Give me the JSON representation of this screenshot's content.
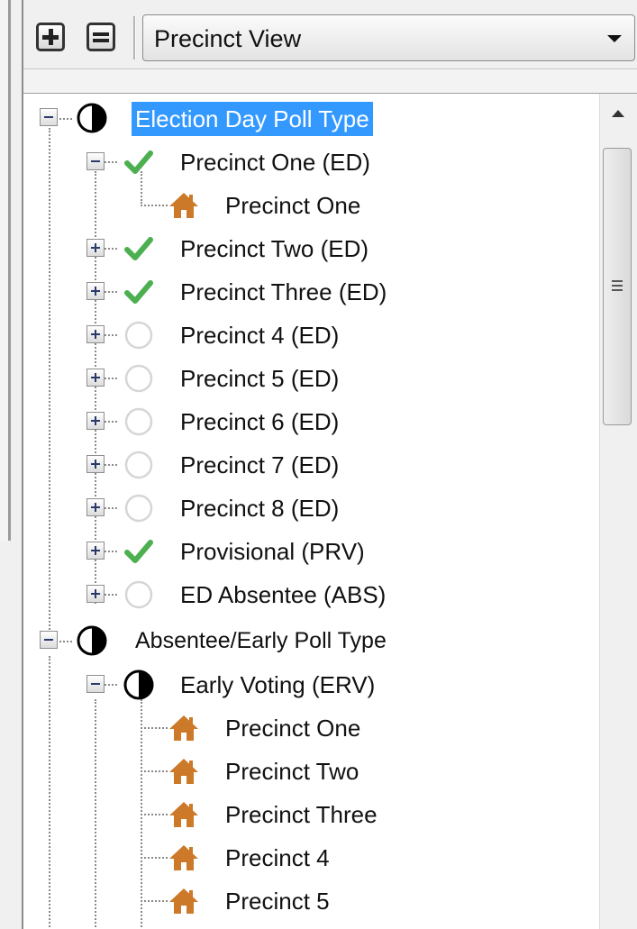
{
  "toolbar": {
    "expand_all": "expand-all",
    "collapse_all": "collapse-all",
    "view_select": {
      "value": "Precinct View"
    }
  },
  "tree": {
    "groups": [
      {
        "label": "Election Day Poll Type",
        "icon": "half-circle-icon",
        "selected": true,
        "expanded": true,
        "children": [
          {
            "label": "Precinct One (ED)",
            "status": "check",
            "expanded": true,
            "children": [
              {
                "label": "Precinct One",
                "icon": "house-icon"
              }
            ]
          },
          {
            "label": "Precinct Two (ED)",
            "status": "check"
          },
          {
            "label": "Precinct Three (ED)",
            "status": "check"
          },
          {
            "label": "Precinct 4 (ED)",
            "status": "empty"
          },
          {
            "label": "Precinct 5 (ED)",
            "status": "empty"
          },
          {
            "label": "Precinct 6 (ED)",
            "status": "empty"
          },
          {
            "label": "Precinct 7 (ED)",
            "status": "empty"
          },
          {
            "label": "Precinct 8 (ED)",
            "status": "empty"
          },
          {
            "label": "Provisional (PRV)",
            "status": "check"
          },
          {
            "label": "ED Absentee (ABS)",
            "status": "empty"
          }
        ]
      },
      {
        "label": "Absentee/Early Poll Type",
        "icon": "half-circle-icon",
        "expanded": true,
        "children": [
          {
            "label": "Early Voting (ERV)",
            "status": "half",
            "expanded": true,
            "children": [
              {
                "label": "Precinct One",
                "icon": "house-icon"
              },
              {
                "label": "Precinct Two",
                "icon": "house-icon"
              },
              {
                "label": "Precinct Three",
                "icon": "house-icon"
              },
              {
                "label": "Precinct 4",
                "icon": "house-icon"
              },
              {
                "label": "Precinct 5",
                "icon": "house-icon"
              }
            ]
          }
        ]
      }
    ]
  },
  "colors": {
    "selection": "#3399ff",
    "check": "#4caf50",
    "house": "#cc7a29",
    "empty_circle": "#d6d6d6"
  }
}
